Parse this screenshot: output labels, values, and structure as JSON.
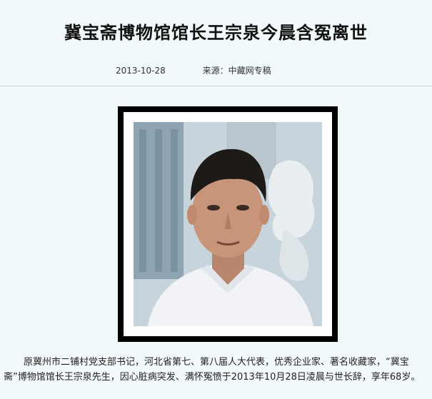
{
  "article": {
    "title": "冀宝斋博物馆馆长王宗泉今晨含冤离世",
    "date": "2013-10-28",
    "source": "来源：中藏网专稿",
    "paragraph": "原冀州市二铺村党支部书记，河北省第七、第八届人大代表，优秀企业家、著名收藏家，“冀宝斋”博物馆馆长王宗泉先生，因心脏病突发、满怀冤愤于2013年10月28日凌晨与世长辞，享年68岁。"
  }
}
